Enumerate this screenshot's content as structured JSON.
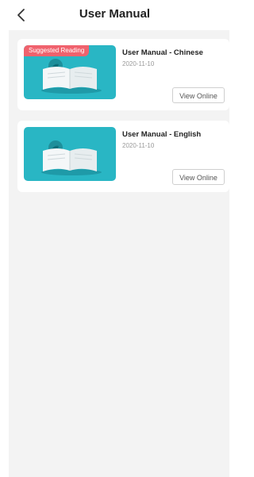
{
  "header": {
    "title": "User Manual",
    "back_icon": "chevron-left-icon"
  },
  "manuals": [
    {
      "badge": "Suggested Reading",
      "title": "User Manual - Chinese",
      "date": "2020-11-10",
      "button_label": "View Online",
      "thumbnail_icon": "open-book-icon"
    },
    {
      "title": "User Manual - English",
      "date": "2020-11-10",
      "button_label": "View Online",
      "thumbnail_icon": "open-book-icon"
    }
  ],
  "colors": {
    "thumbnail_bg": "#29b6c4",
    "badge_bg": "#f0626d",
    "page_bg": "#f3f3f3"
  }
}
